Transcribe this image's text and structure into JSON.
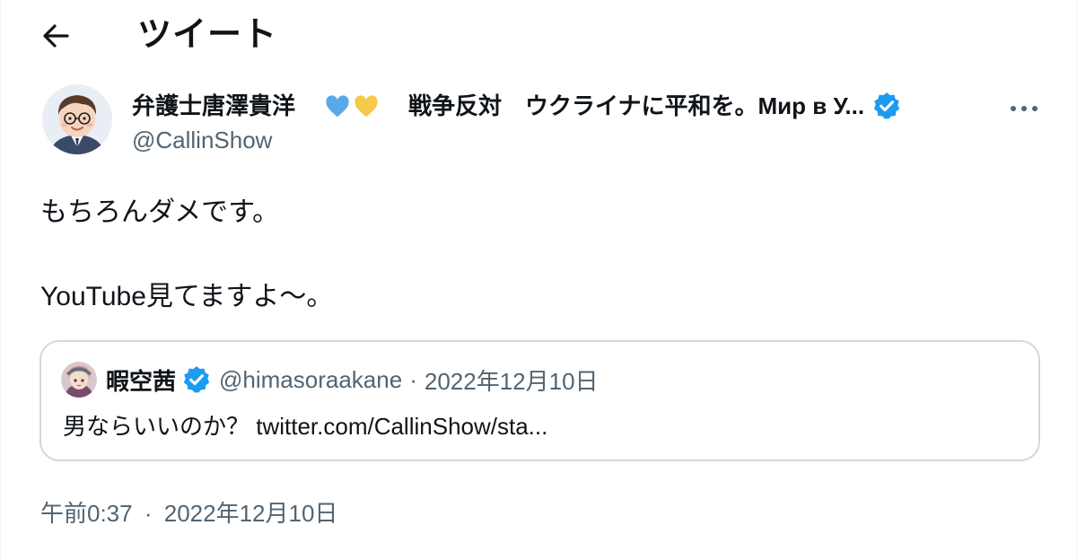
{
  "header": {
    "title": "ツイート",
    "back_icon": "arrow-left-icon"
  },
  "author": {
    "name_prefix": "弁護士唐澤貴洋",
    "name_suffix": "戦争反対　ウクライナに平和を。Мир в У...",
    "handle": "@CallinShow",
    "verified": true,
    "heart_colors": [
      "#5aa9e6",
      "#f5c94a"
    ]
  },
  "tweet": {
    "line1": "もちろんダメです。",
    "line2": "YouTube見てますよ〜。"
  },
  "quote": {
    "name": "暇空茜",
    "handle": "@himasoraakane",
    "separator": "·",
    "date": "2022年12月10日",
    "text": "男ならいいのか？ twitter.com/CallinShow/sta..."
  },
  "meta": {
    "time": "午前0:37",
    "separator": "·",
    "date": "2022年12月10日"
  },
  "colors": {
    "verified": "#1d9bf0",
    "secondary_text": "#536471",
    "border": "#cfd9de"
  }
}
